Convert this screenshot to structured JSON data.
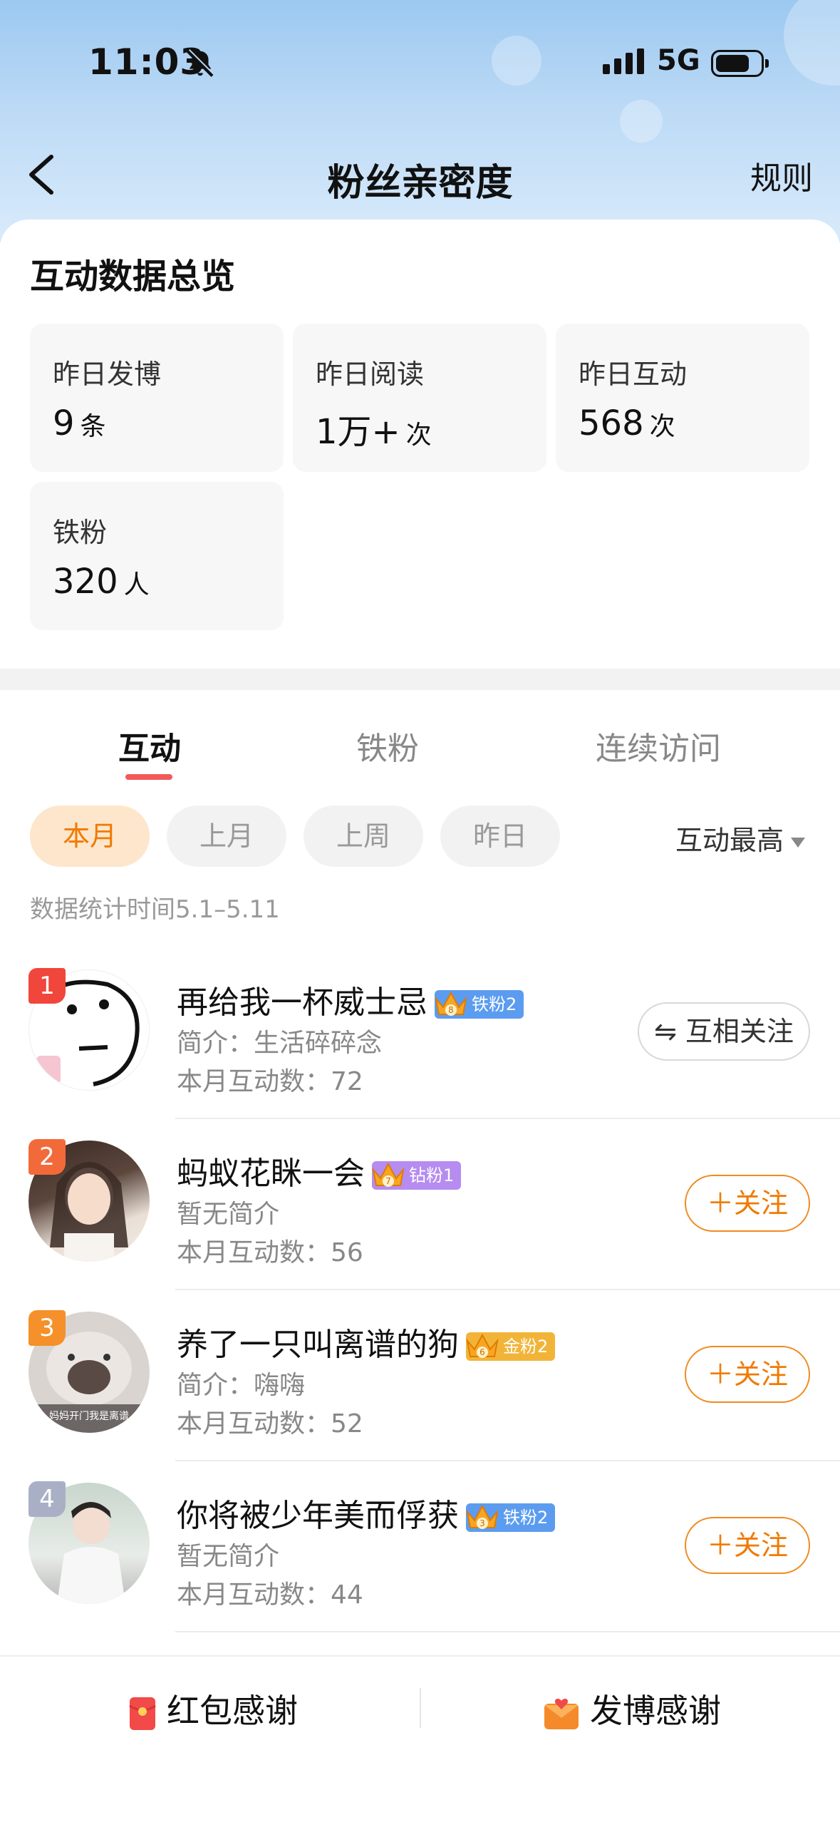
{
  "status_bar": {
    "time": "11:03",
    "network": "5G"
  },
  "nav": {
    "title": "粉丝亲密度",
    "rule_label": "规则"
  },
  "overview": {
    "heading": "互动数据总览",
    "stats": [
      {
        "label": "昨日发博",
        "value": "9",
        "unit": "条"
      },
      {
        "label": "昨日阅读",
        "value": "1万+",
        "unit": "次"
      },
      {
        "label": "昨日互动",
        "value": "568",
        "unit": "次"
      },
      {
        "label": "铁粉",
        "value": "320",
        "unit": "人"
      }
    ]
  },
  "tabs": [
    "互动",
    "铁粉",
    "连续访问"
  ],
  "filters": [
    "本月",
    "上月",
    "上周",
    "昨日"
  ],
  "sort_label": "互动最高",
  "stat_time": "数据统计时间5.1–5.11",
  "fans": [
    {
      "rank": "1",
      "name": "再给我一杯威士忌",
      "badge": "铁粉2",
      "badge_level": "8",
      "intro": "简介：生活碎碎念",
      "count": "本月互动数：72",
      "action": "⇋ 互相关注"
    },
    {
      "rank": "2",
      "name": "蚂蚁花眯一会",
      "badge": "钻粉1",
      "badge_level": "7",
      "intro": "暂无简介",
      "count": "本月互动数：56",
      "action": "＋关注"
    },
    {
      "rank": "3",
      "name": "养了一只叫离谱的狗",
      "badge": "金粉2",
      "badge_level": "6",
      "intro": "简介：嗨嗨",
      "count": "本月互动数：52",
      "action": "＋关注"
    },
    {
      "rank": "4",
      "name": "你将被少年美而俘获",
      "badge": "铁粉2",
      "badge_level": "3",
      "intro": "暂无简介",
      "count": "本月互动数：44",
      "action": "＋关注"
    }
  ],
  "avatar_text": "妈妈开门我是离谱",
  "bottom_bar": {
    "red_packet": "红包感谢",
    "post": "发博感谢"
  },
  "colors": {
    "accent": "#f07a00",
    "tab_indicator": "#f25a5a",
    "rank1": "#f0463c",
    "rank2": "#f36a3a",
    "rank3": "#f5902a",
    "rank4": "#a9b0c6"
  }
}
